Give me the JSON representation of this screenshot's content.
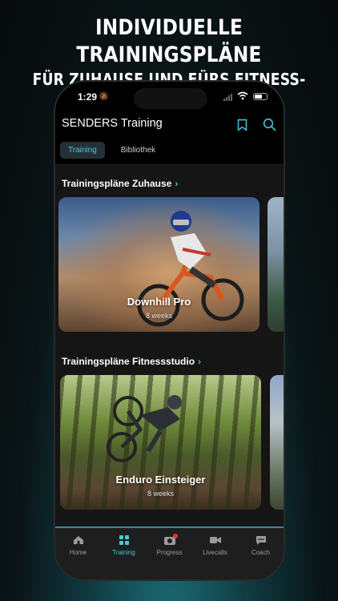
{
  "headline": {
    "line1": "INDIVIDUELLE TRAININGSPLÄNE",
    "line2": "FÜR ZUHAUSE UND FÜRS FITNESS-STUDIO"
  },
  "status_bar": {
    "time": "1:29"
  },
  "app": {
    "title": "SENDERS Training",
    "tabs": [
      {
        "label": "Training",
        "active": true
      },
      {
        "label": "Bibliothek",
        "active": false
      }
    ]
  },
  "sections": [
    {
      "title": "Trainingspläne Zuhause",
      "cards": [
        {
          "name": "Downhill Pro",
          "duration": "8 weeks"
        }
      ]
    },
    {
      "title": "Trainingspläne Fitnessstudio",
      "cards": [
        {
          "name": "Enduro Einsteiger",
          "duration": "8 weeks"
        }
      ]
    }
  ],
  "tab_bar": [
    {
      "label": "Home",
      "icon": "home-icon",
      "active": false
    },
    {
      "label": "Training",
      "icon": "grid-icon",
      "active": true
    },
    {
      "label": "Progress",
      "icon": "camera-icon",
      "active": false,
      "badge": true
    },
    {
      "label": "Livecalls",
      "icon": "video-icon",
      "active": false
    },
    {
      "label": "Coach",
      "icon": "chat-icon",
      "active": false
    }
  ],
  "colors": {
    "accent": "#4fc4d6",
    "badge": "#e53935"
  }
}
